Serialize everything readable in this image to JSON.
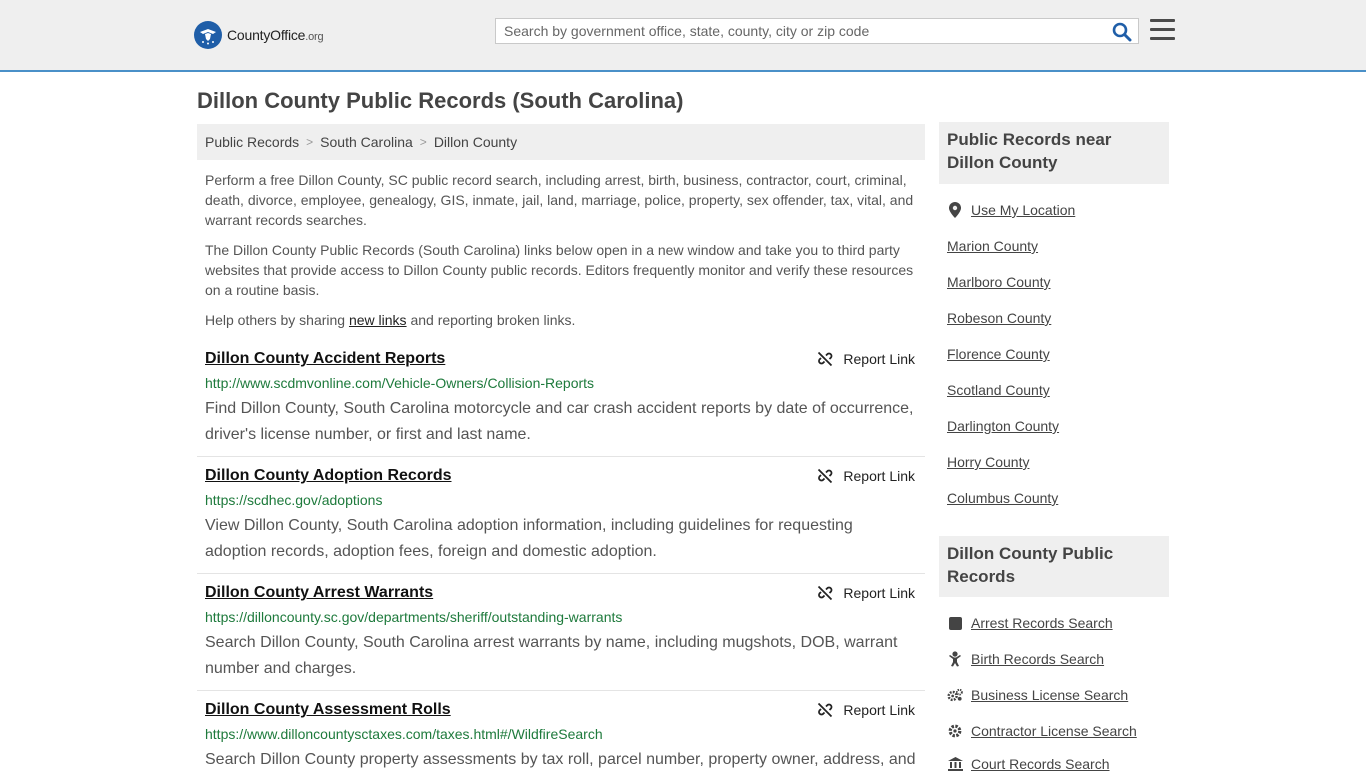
{
  "header": {
    "logo_main": "CountyOffice",
    "logo_tld": ".org",
    "search_placeholder": "Search by government office, state, county, city or zip code"
  },
  "page": {
    "title": "Dillon County Public Records (South Carolina)"
  },
  "breadcrumb": [
    "Public Records",
    "South Carolina",
    "Dillon County"
  ],
  "intro": {
    "p1": "Perform a free Dillon County, SC public record search, including arrest, birth, business, contractor, court, criminal, death, divorce, employee, genealogy, GIS, inmate, jail, land, marriage, police, property, sex offender, tax, vital, and warrant records searches.",
    "p2": "The Dillon County Public Records (South Carolina) links below open in a new window and take you to third party websites that provide access to Dillon County public records. Editors frequently monitor and verify these resources on a routine basis.",
    "p3_before": "Help others by sharing ",
    "p3_link": "new links",
    "p3_after": " and reporting broken links."
  },
  "report_label": "Report Link",
  "records": [
    {
      "title": "Dillon County Accident Reports",
      "url": "http://www.scdmvonline.com/Vehicle-Owners/Collision-Reports",
      "desc": "Find Dillon County, South Carolina motorcycle and car crash accident reports by date of occurrence, driver's license number, or first and last name."
    },
    {
      "title": "Dillon County Adoption Records",
      "url": "https://scdhec.gov/adoptions",
      "desc": "View Dillon County, South Carolina adoption information, including guidelines for requesting adoption records, adoption fees, foreign and domestic adoption."
    },
    {
      "title": "Dillon County Arrest Warrants",
      "url": "https://dilloncounty.sc.gov/departments/sheriff/outstanding-warrants",
      "desc": "Search Dillon County, South Carolina arrest warrants by name, including mugshots, DOB, warrant number and charges."
    },
    {
      "title": "Dillon County Assessment Rolls",
      "url": "https://www.dilloncountysctaxes.com/taxes.html#/WildfireSearch",
      "desc": "Search Dillon County property assessments by tax roll, parcel number, property owner, address, and"
    }
  ],
  "sidebar": {
    "near_title": "Public Records near Dillon County",
    "use_location": "Use My Location",
    "near_items": [
      "Marion County",
      "Marlboro County",
      "Robeson County",
      "Florence County",
      "Scotland County",
      "Darlington County",
      "Horry County",
      "Columbus County"
    ],
    "records_title": "Dillon County Public Records",
    "record_items": [
      {
        "label": "Arrest Records Search",
        "icon": "square-icon"
      },
      {
        "label": "Birth Records Search",
        "icon": "baby-icon"
      },
      {
        "label": "Business License Search",
        "icon": "gears-icon"
      },
      {
        "label": "Contractor License Search",
        "icon": "gear-icon"
      },
      {
        "label": "Court Records Search",
        "icon": "courthouse-icon"
      }
    ]
  }
}
